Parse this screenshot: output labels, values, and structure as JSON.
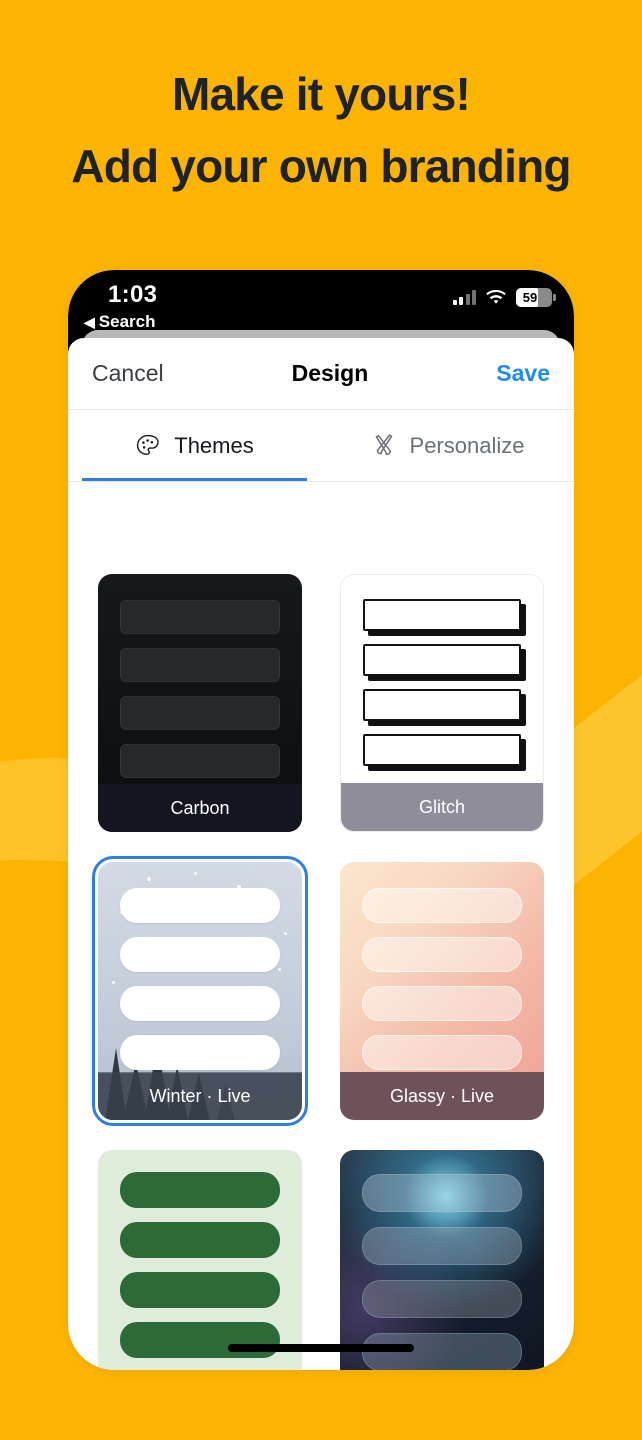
{
  "background": {
    "color": "#FCB400",
    "accent_swirl_color": "#FDC42C"
  },
  "headline": {
    "line1": "Make it yours!",
    "line2": "Add your own branding",
    "color": "#1E2229"
  },
  "phone": {
    "status_bar": {
      "time": "1:03",
      "back_label": "Search",
      "back_icon": "triangle-left-icon",
      "signal_icon": "cellular-bars-icon",
      "wifi_icon": "wifi-icon",
      "battery_icon": "battery-icon",
      "battery_percent": "59"
    },
    "home_indicator": "home-indicator"
  },
  "nav": {
    "cancel_label": "Cancel",
    "title": "Design",
    "save_label": "Save",
    "save_color": "#1f8bf5"
  },
  "tabs": {
    "active_index": 0,
    "underline_color": "#2f7fe0",
    "items": [
      {
        "label": "Themes",
        "icon": "palette-icon",
        "active": true
      },
      {
        "label": "Personalize",
        "icon": "brush-pencil-icon",
        "active": false
      }
    ]
  },
  "themes": {
    "selected": "Winter · Live",
    "items": [
      {
        "label": "Carbon",
        "key": "carbon",
        "rows": 4,
        "selected": false,
        "show_label": true
      },
      {
        "label": "Glitch",
        "key": "glitch",
        "rows": 4,
        "selected": false,
        "show_label": true
      },
      {
        "label": "Winter · Live",
        "key": "winter",
        "rows": 4,
        "selected": true,
        "show_label": true
      },
      {
        "label": "Glassy · Live",
        "key": "glassy",
        "rows": 4,
        "selected": false,
        "show_label": true
      },
      {
        "label": "",
        "key": "mint",
        "rows": 4,
        "selected": false,
        "show_label": false
      },
      {
        "label": "",
        "key": "night",
        "rows": 4,
        "selected": false,
        "show_label": false
      }
    ]
  }
}
